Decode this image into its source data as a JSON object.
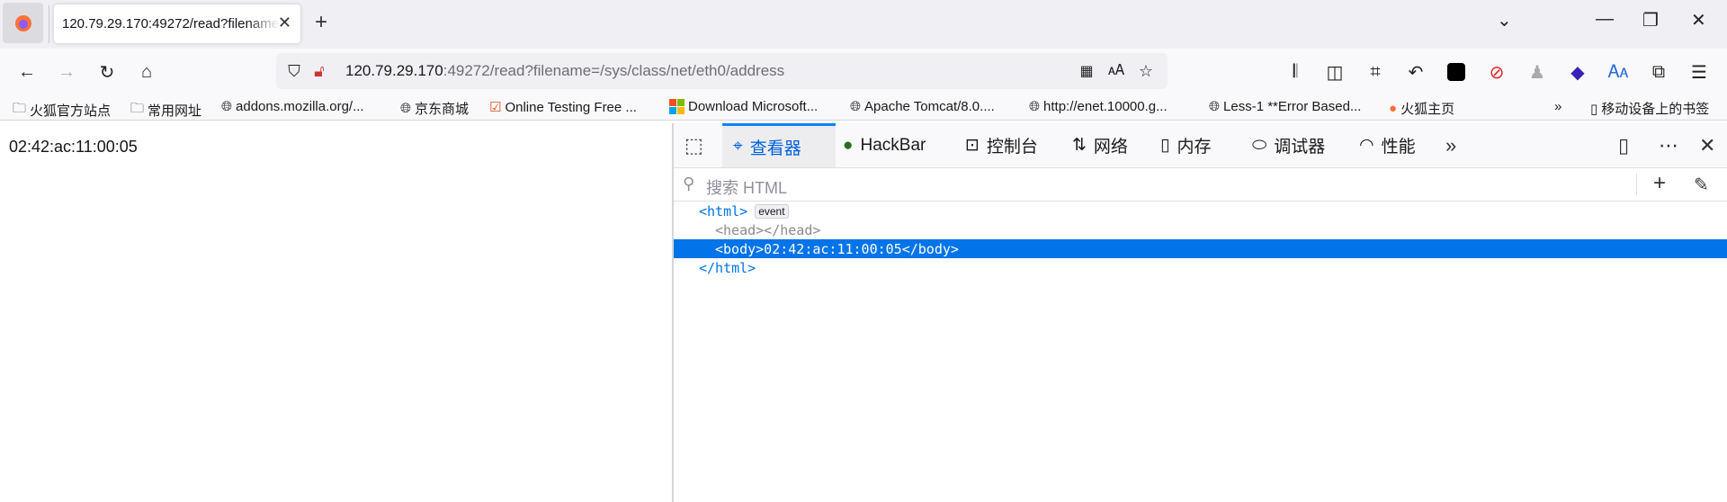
{
  "browser": {
    "tab": {
      "title": "120.79.29.170:49272/read?filename=/sys/class/net/eth0/address"
    },
    "url": {
      "host": "120.79.29.170",
      "rest": ":49272/read?filename=/sys/class/net/eth0/address"
    },
    "bookmarks": [
      {
        "icon": "folder-icon",
        "label": "火狐官方站点"
      },
      {
        "icon": "folder-icon",
        "label": "常用网址"
      },
      {
        "icon": "globe-icon",
        "label": "addons.mozilla.org/..."
      },
      {
        "icon": "globe-icon",
        "label": "京东商城"
      },
      {
        "icon": "checkbox-icon",
        "label": "Online Testing Free ..."
      },
      {
        "icon": "microsoft-icon",
        "label": "Download Microsoft..."
      },
      {
        "icon": "globe-icon",
        "label": "Apache Tomcat/8.0...."
      },
      {
        "icon": "globe-icon",
        "label": "http://enet.10000.g..."
      },
      {
        "icon": "globe-icon",
        "label": "Less-1 **Error Based..."
      },
      {
        "icon": "firefox-icon",
        "label": "火狐主页"
      }
    ],
    "mobile_bookmarks": "移动设备上的书签"
  },
  "page": {
    "text": "02:42:ac:11:00:05"
  },
  "devtools": {
    "tabs": [
      {
        "label": "查看器",
        "icon": "inspector-icon",
        "active": true
      },
      {
        "label": "HackBar",
        "icon": "hackbar-icon"
      },
      {
        "label": "控制台",
        "icon": "console-icon"
      },
      {
        "label": "网络",
        "icon": "network-icon"
      },
      {
        "label": "内存",
        "icon": "memory-icon"
      },
      {
        "label": "调试器",
        "icon": "debugger-icon"
      },
      {
        "label": "性能",
        "icon": "performance-icon"
      }
    ],
    "search_placeholder": "搜索 HTML",
    "tree": {
      "html_open": "<html>",
      "event_badge": "event",
      "head": "<head></head>",
      "body": "<body>02:42:ac:11:00:05</body>",
      "html_close": "</html>"
    },
    "accent": "#0074e8"
  }
}
